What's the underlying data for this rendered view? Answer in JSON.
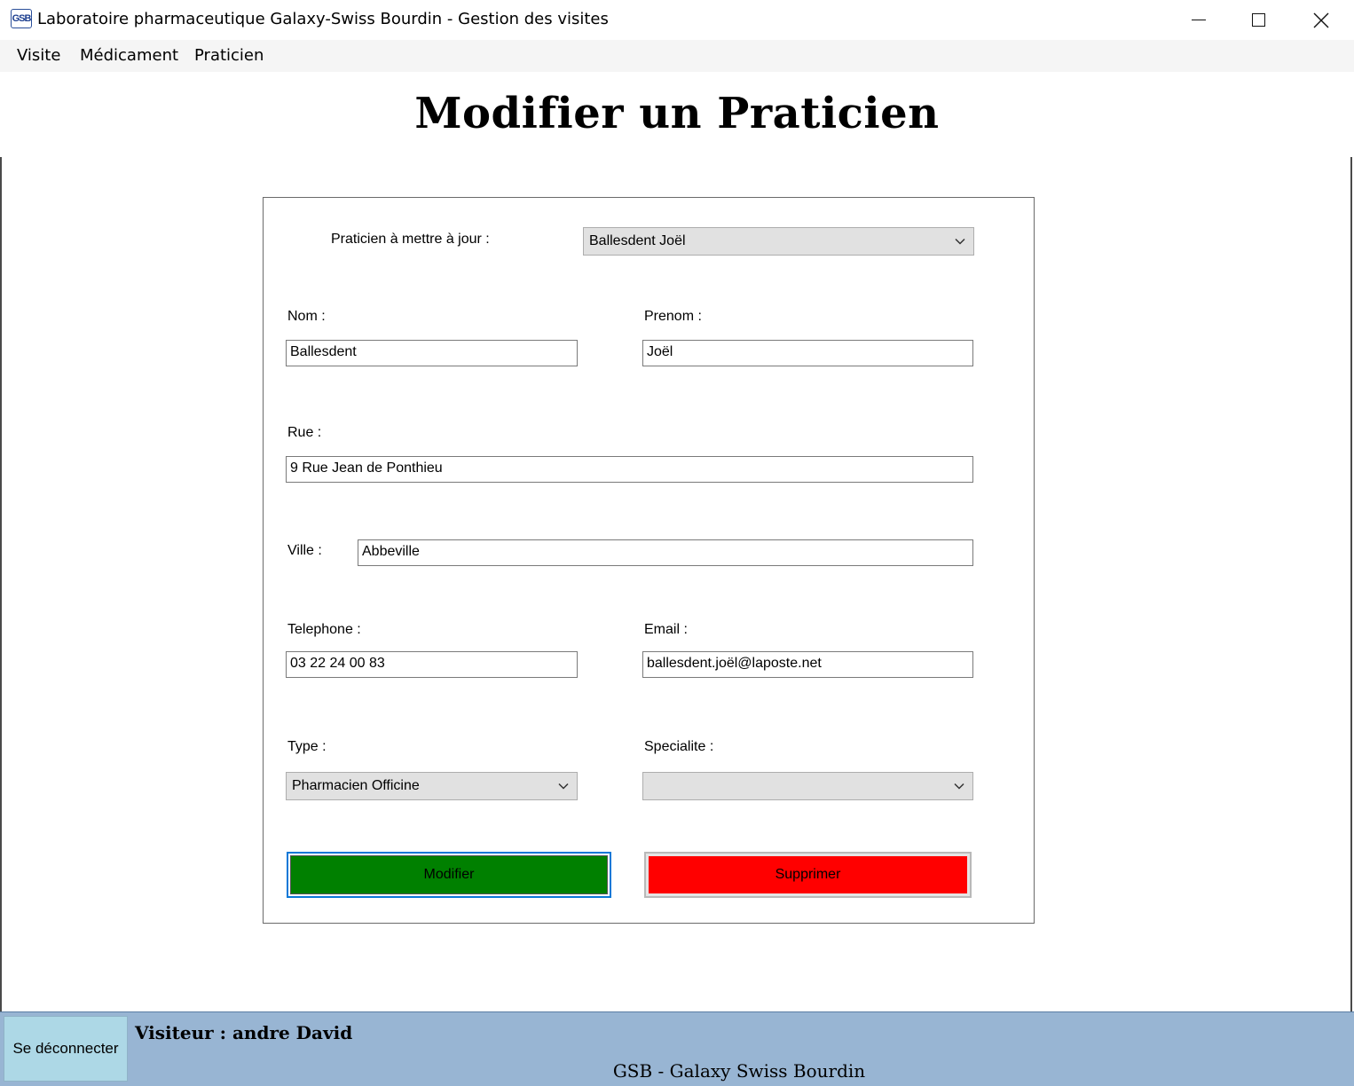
{
  "window": {
    "icon_text": "GSB",
    "title": "Laboratoire pharmaceutique Galaxy-Swiss Bourdin - Gestion des visites"
  },
  "menu": {
    "items": [
      {
        "label": "Visite"
      },
      {
        "label": "Médicament"
      },
      {
        "label": "Praticien"
      }
    ]
  },
  "page": {
    "title": "Modifier un Praticien"
  },
  "form": {
    "praticien_select_label": "Praticien à mettre à jour :",
    "praticien_select_value": "Ballesdent Joël",
    "nom_label": "Nom :",
    "nom_value": "Ballesdent",
    "prenom_label": "Prenom :",
    "prenom_value": "Joël",
    "rue_label": "Rue :",
    "rue_value": "9 Rue Jean de Ponthieu",
    "ville_label": "Ville :",
    "ville_value": "Abbeville",
    "telephone_label": "Telephone :",
    "telephone_value": "03 22 24 00 83",
    "email_label": "Email :",
    "email_value": "ballesdent.joël@laposte.net",
    "type_label": "Type :",
    "type_value": "Pharmacien Officine",
    "specialite_label": "Specialite :",
    "specialite_value": "",
    "modifier_label": "Modifier",
    "supprimer_label": "Supprimer"
  },
  "status": {
    "logout_label": "Se déconnecter",
    "visitor_text": "Visiteur : andre David",
    "brand_text": "GSB - Galaxy Swiss Bourdin"
  },
  "colors": {
    "modifier_button": "#008000",
    "supprimer_button": "#FF0000",
    "status_bar": "#98B5D3",
    "logout_button": "#ADD8E6"
  }
}
